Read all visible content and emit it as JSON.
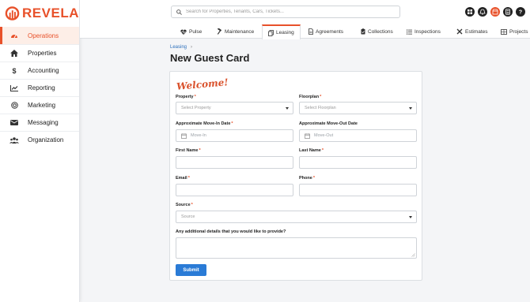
{
  "brand": {
    "name": "REVELA",
    "color": "#e8512a"
  },
  "sidebar": {
    "items": [
      {
        "label": "Operations",
        "icon": "dashboard-icon",
        "active": true
      },
      {
        "label": "Properties",
        "icon": "home-icon"
      },
      {
        "label": "Accounting",
        "icon": "dollar-icon"
      },
      {
        "label": "Reporting",
        "icon": "line-chart-icon"
      },
      {
        "label": "Marketing",
        "icon": "target-icon"
      },
      {
        "label": "Messaging",
        "icon": "envelope-icon"
      },
      {
        "label": "Organization",
        "icon": "users-icon"
      }
    ]
  },
  "search": {
    "placeholder": "Search for Properties, Tenants, Cars, Tickets..."
  },
  "top_icons": [
    "grid-icon",
    "bell-icon",
    "store-icon",
    "calculator-icon",
    "help-icon"
  ],
  "tabs": [
    {
      "label": "Pulse",
      "icon": "heartbeat-icon"
    },
    {
      "label": "Maintenance",
      "icon": "hammer-icon"
    },
    {
      "label": "Leasing",
      "icon": "copy-icon",
      "active": true
    },
    {
      "label": "Agreements",
      "icon": "document-icon"
    },
    {
      "label": "Collections",
      "icon": "clipboard-icon"
    },
    {
      "label": "Inspections",
      "icon": "list-icon"
    },
    {
      "label": "Estimates",
      "icon": "tools-icon"
    },
    {
      "label": "Projects",
      "icon": "projects-icon"
    }
  ],
  "breadcrumb": {
    "parent": "Leasing",
    "separator": "›"
  },
  "page": {
    "title": "New Guest Card"
  },
  "form": {
    "welcome": "Welcome!",
    "property": {
      "label": "Property",
      "required_mark": "*",
      "placeholder": "Select Property"
    },
    "floorplan": {
      "label": "Floorplan",
      "required_mark": "*",
      "placeholder": "Select Floorplan"
    },
    "move_in": {
      "label": "Approximate Move-In Date",
      "required_mark": "*",
      "placeholder": "Move-In"
    },
    "move_out": {
      "label": "Approximate Move-Out Date",
      "placeholder": "Move-Out"
    },
    "first_name": {
      "label": "First Name",
      "required_mark": "*",
      "value": ""
    },
    "last_name": {
      "label": "Last Name",
      "required_mark": "*",
      "value": ""
    },
    "email": {
      "label": "Email",
      "required_mark": "*",
      "value": ""
    },
    "phone": {
      "label": "Phone",
      "required_mark": "*",
      "value": ""
    },
    "source": {
      "label": "Source",
      "required_mark": "*",
      "placeholder": "Source"
    },
    "details": {
      "label": "Any additional details that you would like to provide?",
      "value": ""
    },
    "submit_label": "Submit"
  },
  "colors": {
    "accent": "#e8512a",
    "primary_button": "#2a7bd6",
    "link": "#2a6ebb"
  }
}
